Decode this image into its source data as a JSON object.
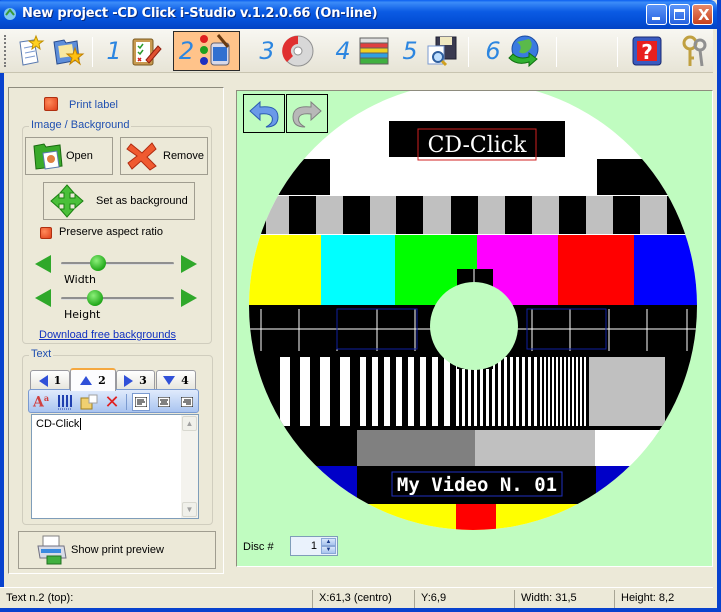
{
  "window": {
    "title": "New project -CD Click i-Studio v.1.2.0.66 (On-line)",
    "controls": [
      "minimize",
      "maximize",
      "close"
    ]
  },
  "toolbar": {
    "items": [
      {
        "name": "new-project",
        "icon": "new-document-star-icon"
      },
      {
        "name": "open-project",
        "icon": "folder-star-icon"
      },
      {
        "step": "1",
        "icon": "clipboard-pencil-icon"
      },
      {
        "step": "2",
        "icon": "paint-bucket-icon",
        "active": true
      },
      {
        "step": "3",
        "icon": "cd-disc-icon"
      },
      {
        "step": "4",
        "icon": "stacked-cases-icon"
      },
      {
        "step": "5",
        "icon": "floppy-magnifier-icon"
      },
      {
        "step": "6",
        "icon": "globe-arrow-icon"
      },
      {
        "name": "help",
        "icon": "help-question-icon"
      },
      {
        "name": "settings",
        "icon": "keys-icon"
      }
    ]
  },
  "left_panel": {
    "print_label": "Print label",
    "image_group": {
      "title": "Image / Background",
      "open_label": "Open",
      "remove_label": "Remove",
      "set_bg_label": "Set as background",
      "preserve_aspect": "Preserve aspect ratio",
      "width_label": "Width",
      "height_label": "Height",
      "width_value": 0.3,
      "height_value": 0.27,
      "download_link": "Download free backgrounds"
    },
    "text_group": {
      "title": "Text",
      "tabs": [
        {
          "label": "1",
          "dir": "left"
        },
        {
          "label": "2",
          "dir": "up",
          "active": true
        },
        {
          "label": "3",
          "dir": "right"
        },
        {
          "label": "4",
          "dir": "down"
        }
      ],
      "tools": [
        "font-icon",
        "barcode-icon",
        "insert-field-icon",
        "delete-icon",
        "align-left-icon",
        "align-center-icon",
        "align-right-icon"
      ],
      "text_value": "CD-Click"
    },
    "print_preview_label": "Show print preview"
  },
  "canvas": {
    "top_text": "CD-Click",
    "bottom_text": "My Video N. 01",
    "disc_label": "Disc #",
    "disc_value": "1",
    "colors": {
      "background": "#C0FCC0",
      "bars": [
        "#FFFF00",
        "#00FFFF",
        "#00FF00",
        "#FF00FF",
        "#FF0000",
        "#0000FF"
      ],
      "grays": [
        "#000000",
        "#808080",
        "#C0C0C0",
        "#FFFFFF"
      ]
    }
  },
  "statusbar": {
    "text": "Text n.2 (top):",
    "x": "X:61,3 (centro)",
    "y": "Y:6,9",
    "width": "Width: 31,5",
    "height": "Height: 8,2"
  }
}
